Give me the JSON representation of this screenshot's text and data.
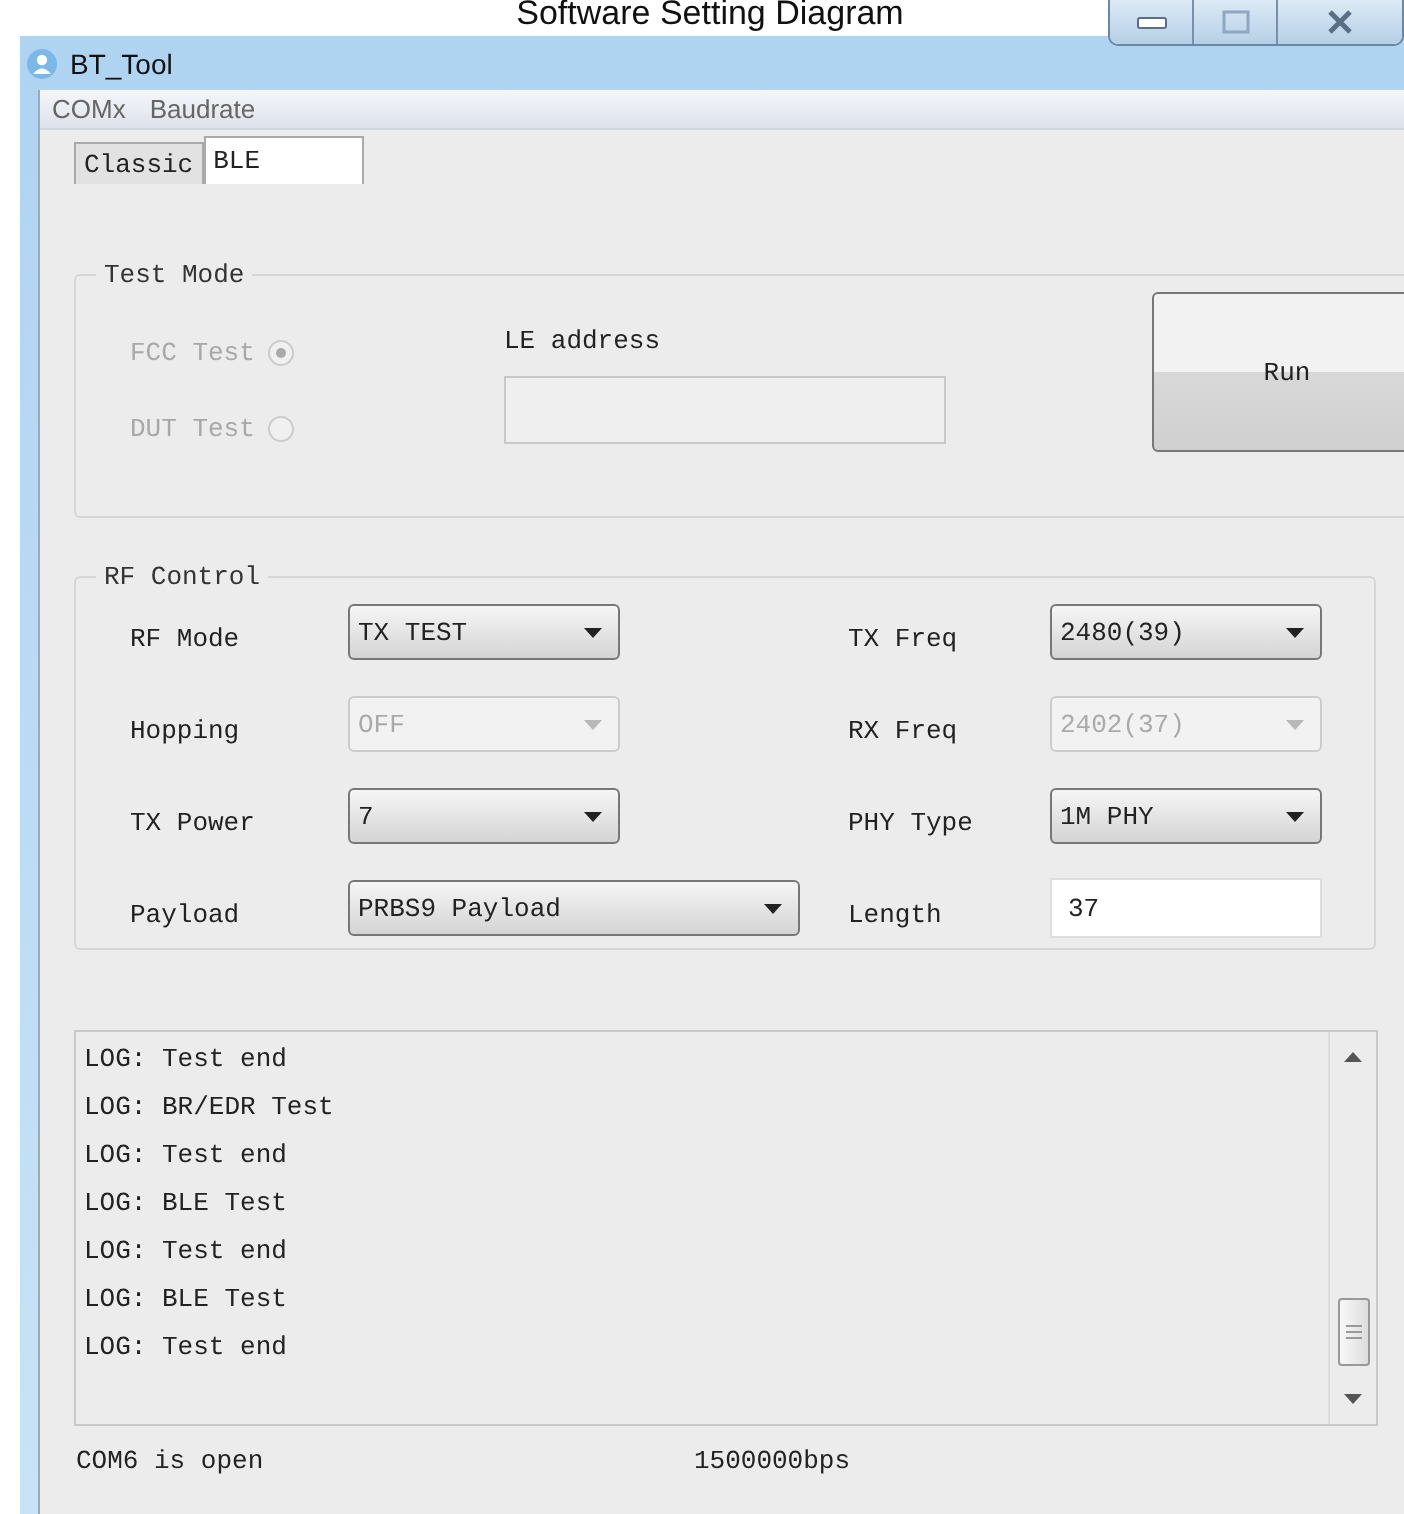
{
  "caption": "Software Setting Diagram",
  "window": {
    "title": "BT_Tool"
  },
  "menu": [
    "COMx",
    "Baudrate"
  ],
  "tabs": [
    {
      "label": "Classic",
      "selected": false
    },
    {
      "label": "BLE",
      "selected": true
    }
  ],
  "test_mode": {
    "title": "Test Mode",
    "options": [
      {
        "label": "FCC Test",
        "selected": true,
        "disabled": true
      },
      {
        "label": "DUT Test",
        "selected": false,
        "disabled": true
      }
    ],
    "address_label": "LE address",
    "run_button": "Run"
  },
  "rf_control": {
    "title": "RF Control",
    "rows": [
      {
        "left": {
          "label": "RF Mode",
          "kind": "dropdown",
          "value": "TX TEST",
          "disabled": false
        },
        "right": {
          "label": "TX Freq",
          "kind": "dropdown",
          "value": "2480(39)",
          "disabled": false
        }
      },
      {
        "left": {
          "label": "Hopping",
          "kind": "dropdown",
          "value": "OFF",
          "disabled": true
        },
        "right": {
          "label": "RX Freq",
          "kind": "dropdown",
          "value": "2402(37)",
          "disabled": true
        }
      },
      {
        "left": {
          "label": "TX Power",
          "kind": "dropdown",
          "value": "7",
          "disabled": false
        },
        "right": {
          "label": "PHY Type",
          "kind": "dropdown",
          "value": "1M PHY",
          "disabled": false
        }
      },
      {
        "left": {
          "label": "Payload",
          "kind": "dropdown",
          "value": "PRBS9 Payload",
          "disabled": false
        },
        "right": {
          "label": "Length",
          "kind": "input",
          "value": "37",
          "disabled": false
        }
      }
    ]
  },
  "log": [
    "LOG: Test end",
    "LOG: BR/EDR Test",
    "LOG: Test end",
    "LOG: BLE Test",
    "LOG: Test end",
    "LOG: BLE Test",
    "LOG: Test end"
  ],
  "status_bar": {
    "port": "COM6 is open",
    "baudrate": "1500000bps"
  }
}
